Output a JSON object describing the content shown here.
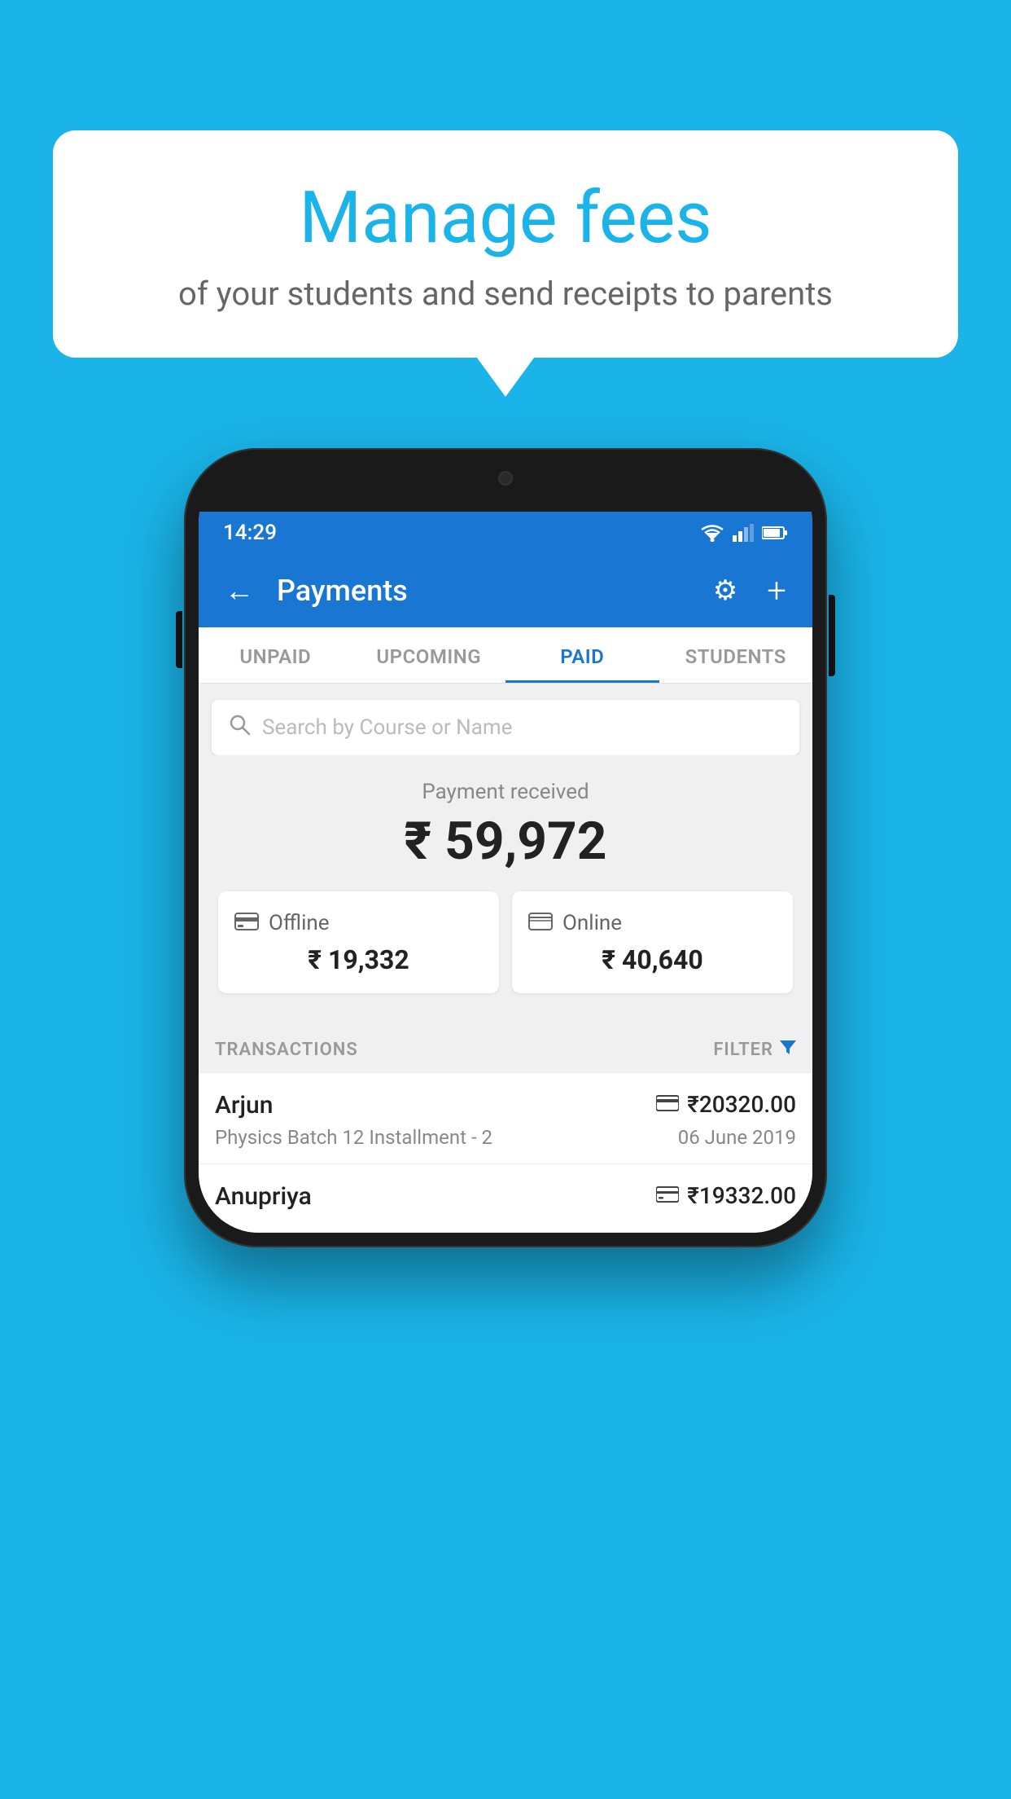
{
  "background_color": "#1ab4e8",
  "speech_bubble": {
    "title": "Manage fees",
    "subtitle": "of your students and send receipts to parents"
  },
  "phone": {
    "status_bar": {
      "time": "14:29",
      "wifi": "▼",
      "signal": "▲",
      "battery": ""
    },
    "app_bar": {
      "back_icon": "←",
      "title": "Payments",
      "gear_icon": "⚙",
      "add_icon": "+"
    },
    "tabs": [
      {
        "label": "UNPAID",
        "active": false
      },
      {
        "label": "UPCOMING",
        "active": false
      },
      {
        "label": "PAID",
        "active": true
      },
      {
        "label": "STUDENTS",
        "active": false
      }
    ],
    "search": {
      "placeholder": "Search by Course or Name",
      "icon": "🔍"
    },
    "payment_summary": {
      "label": "Payment received",
      "amount": "₹ 59,972",
      "offline": {
        "label": "Offline",
        "amount": "₹ 19,332",
        "icon": "💳"
      },
      "online": {
        "label": "Online",
        "amount": "₹ 40,640",
        "icon": "🖥"
      }
    },
    "transactions": {
      "header_label": "TRANSACTIONS",
      "filter_label": "FILTER",
      "rows": [
        {
          "name": "Arjun",
          "course": "Physics Batch 12 Installment - 2",
          "amount": "₹20320.00",
          "date": "06 June 2019",
          "payment_type": "online"
        },
        {
          "name": "Anupriya",
          "course": "",
          "amount": "₹19332.00",
          "date": "",
          "payment_type": "offline"
        }
      ]
    }
  }
}
